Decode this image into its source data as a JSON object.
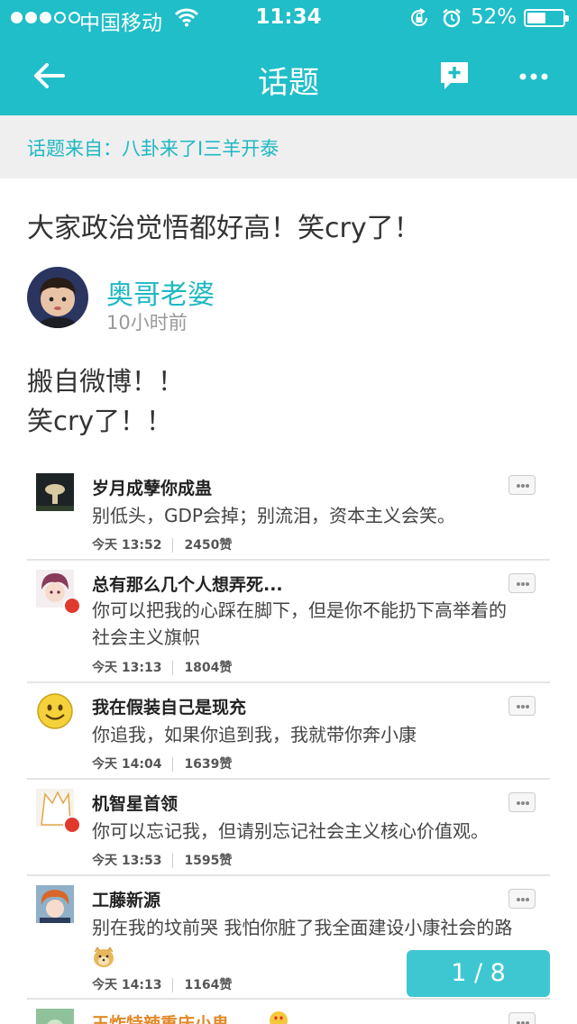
{
  "status_bar": {
    "carrier": "中国移动",
    "time": "11:34",
    "battery_percent": "52%",
    "battery_level": 0.52,
    "signal_bars_filled": 3,
    "signal_bars_total": 5
  },
  "nav": {
    "title": "话题",
    "back_icon": "arrow-left-icon",
    "compose_icon": "comment-add-icon",
    "more_icon": "more-dots-icon"
  },
  "source": {
    "text": "话题来自：八卦来了I三羊开泰"
  },
  "post": {
    "title": "大家政治觉悟都好高！笑cry了！",
    "author": "奥哥老婆",
    "time_ago": "10小时前",
    "body_lines": [
      "搬自微博！！",
      "笑cry了！！"
    ]
  },
  "comments": [
    {
      "name": "岁月成孽你成蛊",
      "lines": [
        "别低头，GDP会掉；别流泪，资本主义会笑。"
      ],
      "time": "今天 13:52",
      "likes": "2450赞"
    },
    {
      "name": "总有那么几个人想弄死...",
      "lines": [
        "你可以把我的心踩在脚下，但是你不能扔下高举着的",
        "社会主义旗帜"
      ],
      "time": "今天 13:13",
      "likes": "1804赞"
    },
    {
      "name": "我在假装自己是现充",
      "lines": [
        "你追我，如果你追到我，我就带你奔小康"
      ],
      "time": "今天 14:04",
      "likes": "1639赞"
    },
    {
      "name": "机智星首领",
      "lines": [
        "你可以忘记我，但请别忘记社会主义核心价值观。"
      ],
      "time": "今天 13:53",
      "likes": "1595赞"
    },
    {
      "name": "工藤新源",
      "lines": [
        "别在我的坟前哭 我怕你脏了我全面建设小康社会的路"
      ],
      "time": "今天 14:13",
      "likes": "1164赞"
    },
    {
      "name": "王炸特辣重庆小鬼"
    }
  ],
  "pager": {
    "text": "1 / 8"
  },
  "colors": {
    "brand_teal": "#1fbec9",
    "link_teal": "#1fb8c3",
    "pager_bg": "#3fc7d1"
  }
}
